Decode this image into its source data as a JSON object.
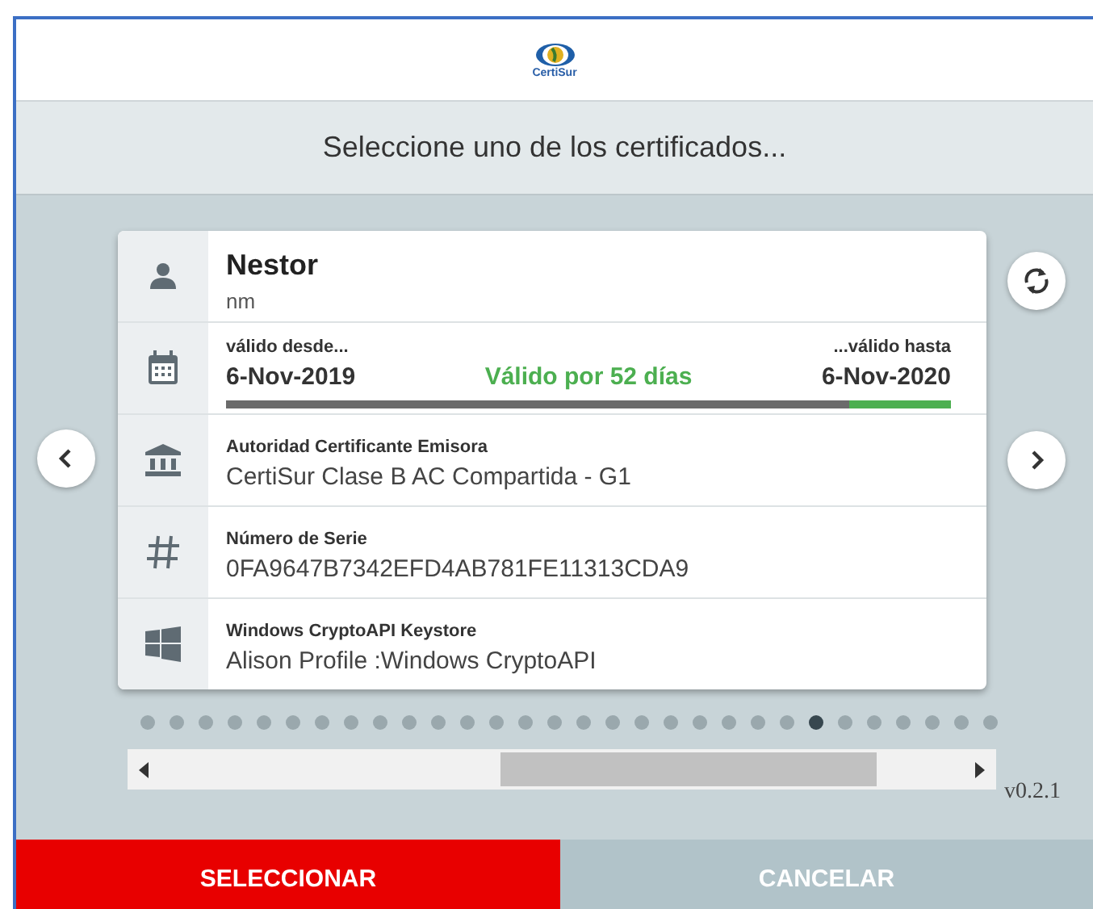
{
  "header": {
    "logo_text": "CertiSur"
  },
  "prompt": "Seleccione uno de los certificados...",
  "certificate": {
    "name": "Nestor",
    "subtitle": "nm",
    "validity": {
      "from_label": "válido desde...",
      "from": "6-Nov-2019",
      "status": "Válido por 52 días",
      "to_label": "...válido hasta",
      "to": "6-Nov-2020",
      "level": 0.86
    },
    "fields": [
      {
        "kind": "authority",
        "label": "Autoridad Certificante Emisora",
        "value": "CertiSur Clase B AC Compartida - G1"
      },
      {
        "kind": "serial",
        "label": "Número de Serie",
        "value": "0FA9647B7342EFD4AB781FE11313CDA9"
      },
      {
        "kind": "keystore",
        "label": "Windows CryptoAPI Keystore",
        "value": "Alison Profile :Windows CryptoAPI"
      }
    ]
  },
  "pager": [
    {
      "selected": false
    },
    {
      "selected": false
    },
    {
      "selected": false
    },
    {
      "selected": false
    },
    {
      "selected": false
    },
    {
      "selected": false
    },
    {
      "selected": false
    },
    {
      "selected": false
    },
    {
      "selected": false
    },
    {
      "selected": false
    },
    {
      "selected": false
    },
    {
      "selected": false
    },
    {
      "selected": false
    },
    {
      "selected": false
    },
    {
      "selected": false
    },
    {
      "selected": false
    },
    {
      "selected": false
    },
    {
      "selected": false
    },
    {
      "selected": false
    },
    {
      "selected": false
    },
    {
      "selected": false
    },
    {
      "selected": false
    },
    {
      "selected": false
    },
    {
      "selected": true
    },
    {
      "selected": false
    },
    {
      "selected": false
    },
    {
      "selected": false
    },
    {
      "selected": false
    },
    {
      "selected": false
    },
    {
      "selected": false
    }
  ],
  "version": "v0.2.1",
  "buttons": [
    {
      "kind": "primary",
      "label": "SELECCIONAR"
    },
    {
      "kind": "secondary",
      "label": "CANCELAR"
    }
  ]
}
